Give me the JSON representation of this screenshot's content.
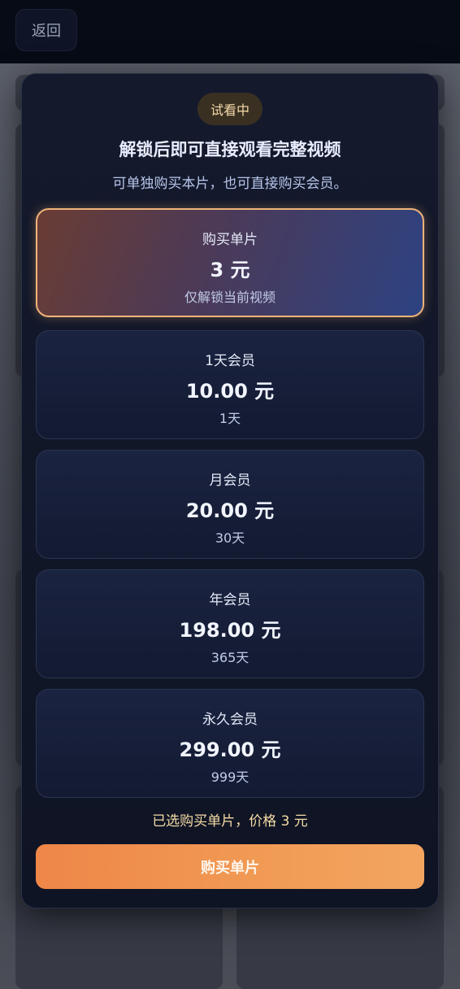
{
  "header": {
    "back_label": "返回"
  },
  "modal": {
    "badge": "试看中",
    "title": "解锁后即可直接观看完整视频",
    "subtitle": "可单独购买本片，也可直接购买会员。",
    "options": [
      {
        "name": "购买单片",
        "price": "3 元",
        "desc": "仅解锁当前视频",
        "selected": true
      },
      {
        "name": "1天会员",
        "price": "10.00 元",
        "desc": "1天",
        "selected": false
      },
      {
        "name": "月会员",
        "price": "20.00 元",
        "desc": "30天",
        "selected": false
      },
      {
        "name": "年会员",
        "price": "198.00 元",
        "desc": "365天",
        "selected": false
      },
      {
        "name": "永久会员",
        "price": "299.00 元",
        "desc": "999天",
        "selected": false
      }
    ],
    "selection_text": "已选购买单片，价格 3 元",
    "buy_label": "购买单片"
  },
  "colors": {
    "accent": "#ee8648",
    "selected_border": "#f0b37a",
    "badge_text": "#f3d9a8"
  }
}
